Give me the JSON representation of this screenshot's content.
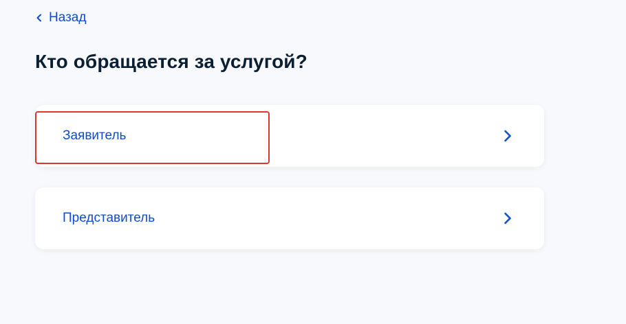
{
  "nav": {
    "back_label": "Назад",
    "back_icon": "chevron-left-icon"
  },
  "page": {
    "title": "Кто обращается за услугой?"
  },
  "options": [
    {
      "label": "Заявитель",
      "icon": "chevron-right-icon",
      "highlighted": true
    },
    {
      "label": "Представитель",
      "icon": "chevron-right-icon",
      "highlighted": false
    }
  ],
  "colors": {
    "background": "#f8f9fc",
    "accent": "#0d4cd3",
    "title": "#0b1f33",
    "card": "#ffffff",
    "highlight_border": "#d9372e"
  }
}
